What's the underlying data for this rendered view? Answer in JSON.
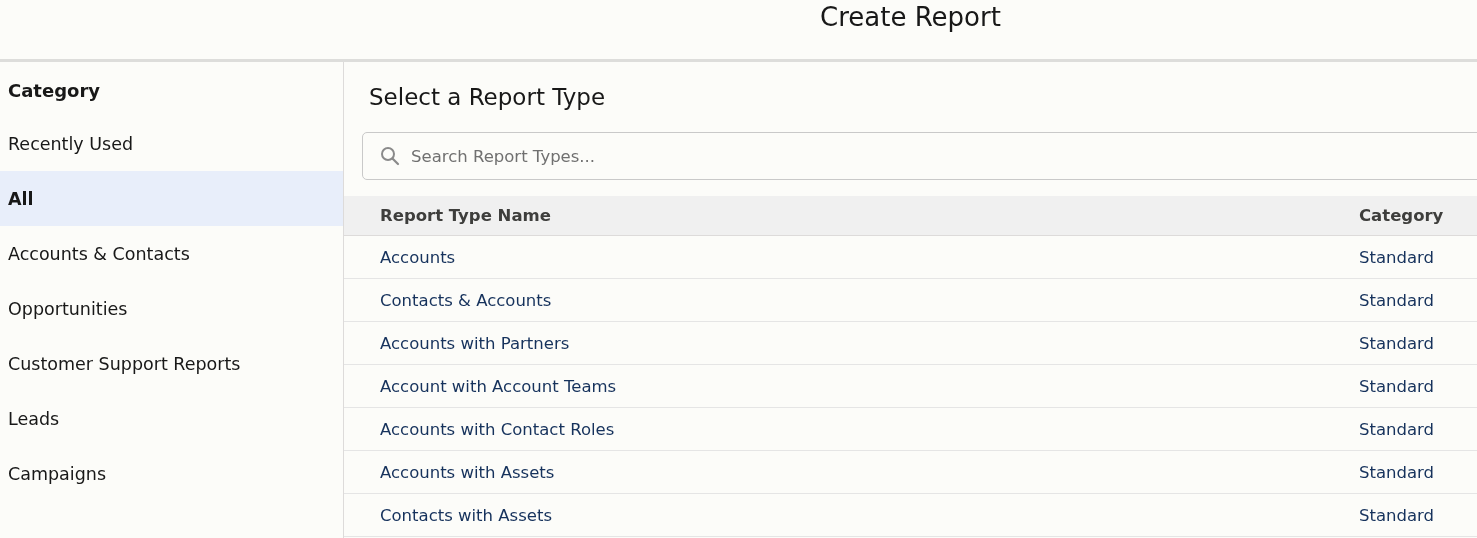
{
  "window": {
    "title": "Create Report"
  },
  "sidebar": {
    "heading": "Category",
    "items": [
      {
        "label": "Recently Used",
        "selected": false
      },
      {
        "label": "All",
        "selected": true
      },
      {
        "label": "Accounts & Contacts",
        "selected": false
      },
      {
        "label": "Opportunities",
        "selected": false
      },
      {
        "label": "Customer Support Reports",
        "selected": false
      },
      {
        "label": "Leads",
        "selected": false
      },
      {
        "label": "Campaigns",
        "selected": false
      }
    ]
  },
  "main": {
    "heading": "Select a Report Type",
    "search": {
      "placeholder": "Search Report Types..."
    },
    "table": {
      "columns": [
        "Report Type Name",
        "Category"
      ],
      "rows": [
        {
          "name": "Accounts",
          "category": "Standard"
        },
        {
          "name": "Contacts & Accounts",
          "category": "Standard"
        },
        {
          "name": "Accounts with Partners",
          "category": "Standard"
        },
        {
          "name": "Account with Account Teams",
          "category": "Standard"
        },
        {
          "name": "Accounts with Contact Roles",
          "category": "Standard"
        },
        {
          "name": "Accounts with Assets",
          "category": "Standard"
        },
        {
          "name": "Contacts with Assets",
          "category": "Standard"
        }
      ]
    }
  }
}
